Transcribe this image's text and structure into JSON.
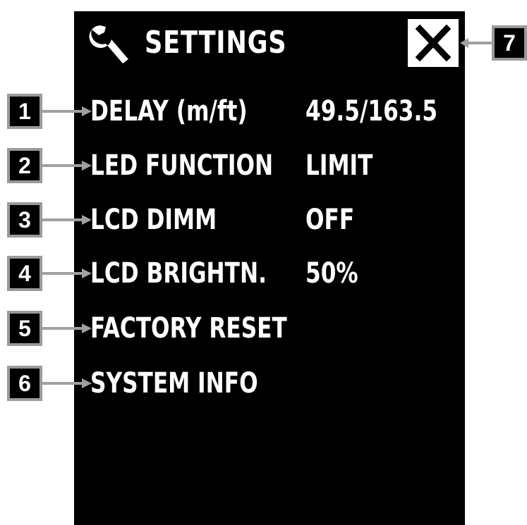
{
  "header": {
    "title": "SETTINGS",
    "icon": "wrench-icon",
    "close_icon": "close-icon"
  },
  "menu": [
    {
      "badge": "1",
      "label": "DELAY (m/ft)",
      "value": "49.5/163.5"
    },
    {
      "badge": "2",
      "label": "LED FUNCTION",
      "value": "LIMIT"
    },
    {
      "badge": "3",
      "label": "LCD DIMM",
      "value": "OFF"
    },
    {
      "badge": "4",
      "label": "LCD BRIGHTN.",
      "value": "50%"
    },
    {
      "badge": "5",
      "label": "FACTORY RESET",
      "value": ""
    },
    {
      "badge": "6",
      "label": "SYSTEM INFO",
      "value": ""
    }
  ],
  "close_badge": "7",
  "colors": {
    "screen_bg": "#000000",
    "text": "#ffffff",
    "badge_border": "#9a9a9a",
    "arrow": "#a0a0a0"
  }
}
